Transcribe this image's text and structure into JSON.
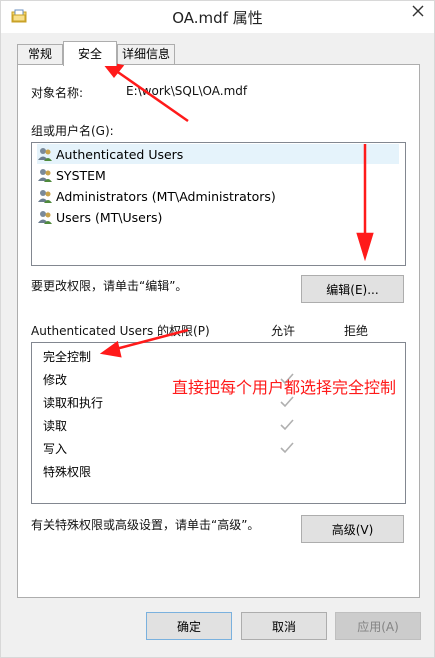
{
  "window": {
    "title": "OA.mdf 属性"
  },
  "tabs": [
    {
      "label": "常规",
      "active": false
    },
    {
      "label": "安全",
      "active": true
    },
    {
      "label": "详细信息",
      "active": false
    }
  ],
  "object": {
    "label": "对象名称:",
    "value": "E:\\work\\SQL\\OA.mdf"
  },
  "groups": {
    "label": "组或用户名(G):",
    "items": [
      {
        "label": "Authenticated Users",
        "selected": true
      },
      {
        "label": "SYSTEM",
        "selected": false
      },
      {
        "label": "Administrators (MT\\Administrators)",
        "selected": false
      },
      {
        "label": "Users (MT\\Users)",
        "selected": false
      }
    ]
  },
  "change_hint": "要更改权限，请单击“编辑”。",
  "edit_button": "编辑(E)...",
  "permissions": {
    "header": "Authenticated Users 的权限(P)",
    "allow_label": "允许",
    "deny_label": "拒绝",
    "rows": [
      {
        "label": "完全控制",
        "allow": false
      },
      {
        "label": "修改",
        "allow": true
      },
      {
        "label": "读取和执行",
        "allow": true
      },
      {
        "label": "读取",
        "allow": true
      },
      {
        "label": "写入",
        "allow": true
      },
      {
        "label": "特殊权限",
        "allow": false
      }
    ]
  },
  "advanced_hint": "有关特殊权限或高级设置，请单击“高级”。",
  "advanced_button": "高级(V)",
  "footer": {
    "ok": "确定",
    "cancel": "取消",
    "apply": "应用(A)"
  },
  "annotation": {
    "text": "直接把每个用户都选择完全控制",
    "color": "#ff1a1a"
  }
}
